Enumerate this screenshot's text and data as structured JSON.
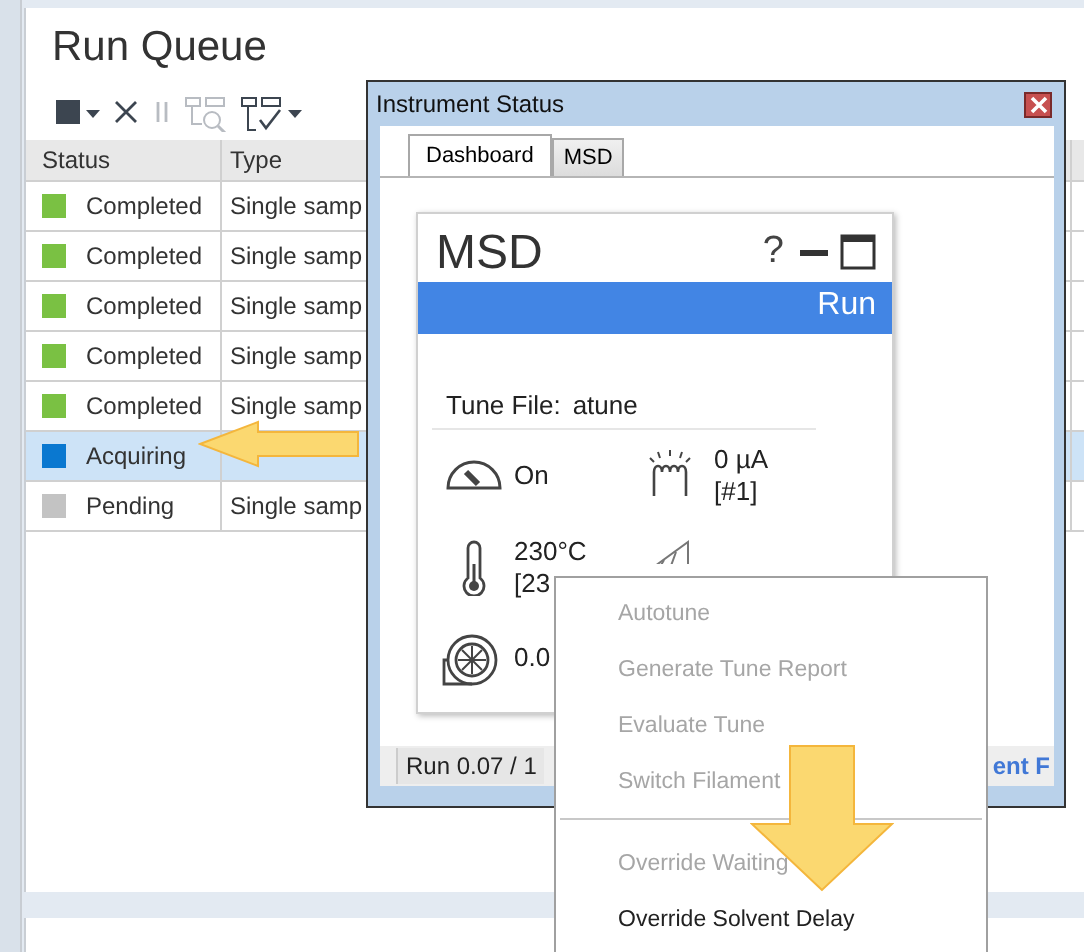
{
  "run_queue": {
    "title": "Run Queue",
    "toolbar": [
      {
        "kind": "stop",
        "disabled": false,
        "dropdown": true
      },
      {
        "kind": "close",
        "disabled": false,
        "dropdown": false
      },
      {
        "kind": "pause",
        "disabled": true,
        "dropdown": false
      },
      {
        "kind": "find",
        "disabled": true,
        "dropdown": false
      },
      {
        "kind": "checklist",
        "disabled": false,
        "dropdown": true
      }
    ],
    "table": {
      "columns": [
        "Status",
        "Type"
      ],
      "rows": [
        {
          "status": "Completed",
          "color": "#7ac143",
          "type": "Single samp",
          "selected": false
        },
        {
          "status": "Completed",
          "color": "#7ac143",
          "type": "Single samp",
          "selected": false
        },
        {
          "status": "Completed",
          "color": "#7ac143",
          "type": "Single samp",
          "selected": false
        },
        {
          "status": "Completed",
          "color": "#7ac143",
          "type": "Single samp",
          "selected": false
        },
        {
          "status": "Completed",
          "color": "#7ac143",
          "type": "Single samp",
          "selected": false
        },
        {
          "status": "Acquiring",
          "color": "#0a78d0",
          "selected": true
        },
        {
          "status": "Pending",
          "color": "#c3c3c3",
          "type": "Single samp",
          "selected": false
        }
      ]
    }
  },
  "instrument_status": {
    "title": "Instrument Status",
    "tabs": [
      {
        "label": "Dashboard",
        "selected": true
      },
      {
        "label": "MSD",
        "selected": false
      }
    ],
    "card": {
      "title": "MSD",
      "help": "?",
      "state": "Run",
      "tune_label": "Tune File:",
      "tune_value": "atune",
      "readings": [
        {
          "kind": "gauge",
          "lines": [
            "On"
          ]
        },
        {
          "kind": "filament",
          "lines": [
            "0 µA",
            "[#1]"
          ]
        },
        {
          "kind": "thermometer",
          "lines": [
            "230°C",
            "[23"
          ]
        },
        {
          "kind": "ramp"
        },
        {
          "kind": "turbo",
          "lines": [
            "0.0"
          ]
        }
      ]
    },
    "status_bar": {
      "run": "Run 0.07 / 1",
      "link": "ent F"
    }
  },
  "context_menu": [
    {
      "kind": "item",
      "label": "Autotune",
      "disabled": true
    },
    {
      "kind": "item",
      "label": "Generate Tune Report",
      "disabled": true
    },
    {
      "kind": "item",
      "label": "Evaluate Tune",
      "disabled": true
    },
    {
      "kind": "item",
      "label": "Switch Filament",
      "disabled": true
    },
    {
      "kind": "separator"
    },
    {
      "kind": "item",
      "label": "Override Waiting",
      "disabled": true
    },
    {
      "kind": "item",
      "label": "Override Solvent Delay",
      "disabled": false
    }
  ]
}
